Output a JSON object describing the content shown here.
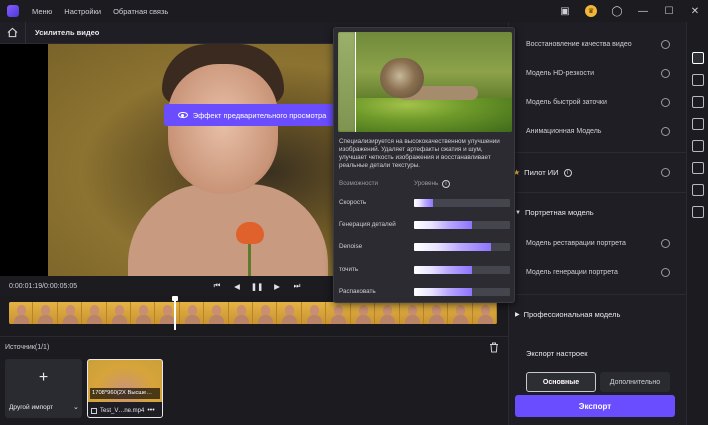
{
  "titlebar": {
    "menu": [
      "Меню",
      "Настройки",
      "Обратная связь"
    ],
    "icons": [
      "screen-icon",
      "crown-icon",
      "user-icon",
      "minimize-icon",
      "maximize-icon",
      "close-icon"
    ]
  },
  "subbar": {
    "title": "Усилитель видео"
  },
  "preview": {
    "button_label": "Эффект предварительного просмотра"
  },
  "controls": {
    "timecode": "0:00:01:19/0:00:05:05"
  },
  "sources": {
    "title": "Источник(1/1)",
    "import_label": "Другой импорт",
    "media": {
      "badge": "1708*960(2X Высше…",
      "name": "Test_V…ne.mp4"
    }
  },
  "tooltip": {
    "description": "Специализируется на высококачественном улучшении изображений. Удаляет артефакты сжатия и шум, улучшает четкость изображения и восстанавливает реальные детали текстуры.",
    "col_features": "Возможности",
    "col_level": "Уровень",
    "features": [
      {
        "name": "Скорость",
        "level": 0.2
      },
      {
        "name": "Генерация деталей",
        "level": 0.6
      },
      {
        "name": "Denoise",
        "level": 0.8
      },
      {
        "name": "точить",
        "level": 0.6
      },
      {
        "name": "Распаковать",
        "level": 0.6
      }
    ]
  },
  "right_panel": {
    "models_top": [
      "Восстановление качества видео",
      "Модель HD-резкости",
      "Модель быстрой заточки",
      "Анимационная Модель"
    ],
    "ai_pilot": "Пилот ИИ",
    "portrait_section": "Портретная модель",
    "portrait_models": [
      "Модель реставрации портрета",
      "Модель генерации портрета"
    ],
    "pro_section": "Профессиональная модель",
    "export_settings": "Экспорт настроек",
    "tab_basic": "Основные",
    "tab_advanced": "Дополнительно",
    "export_button": "Экспорт"
  }
}
